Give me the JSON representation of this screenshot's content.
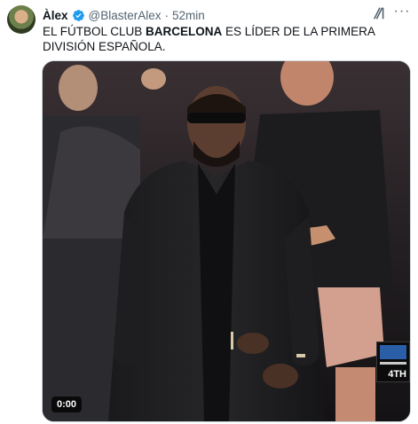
{
  "post": {
    "author_name": "Àlex",
    "author_handle": "@BlasterAlex",
    "separator": "·",
    "time": "52min",
    "text_part1": "EL FÚTBOL CLUB ",
    "text_bold": "BARCELONA",
    "text_part2": " ES LÍDER DE LA PRIMERA DIVISIÓN ESPAÑOLA."
  },
  "media": {
    "video_timestamp": "0:00",
    "scorebug_period": "4TH"
  },
  "icons": {
    "verified": "verified-badge-icon",
    "grok": "grok-icon",
    "more": "more-icon"
  },
  "colors": {
    "verified_blue": "#1d9bf0",
    "secondary_text": "#536471"
  }
}
